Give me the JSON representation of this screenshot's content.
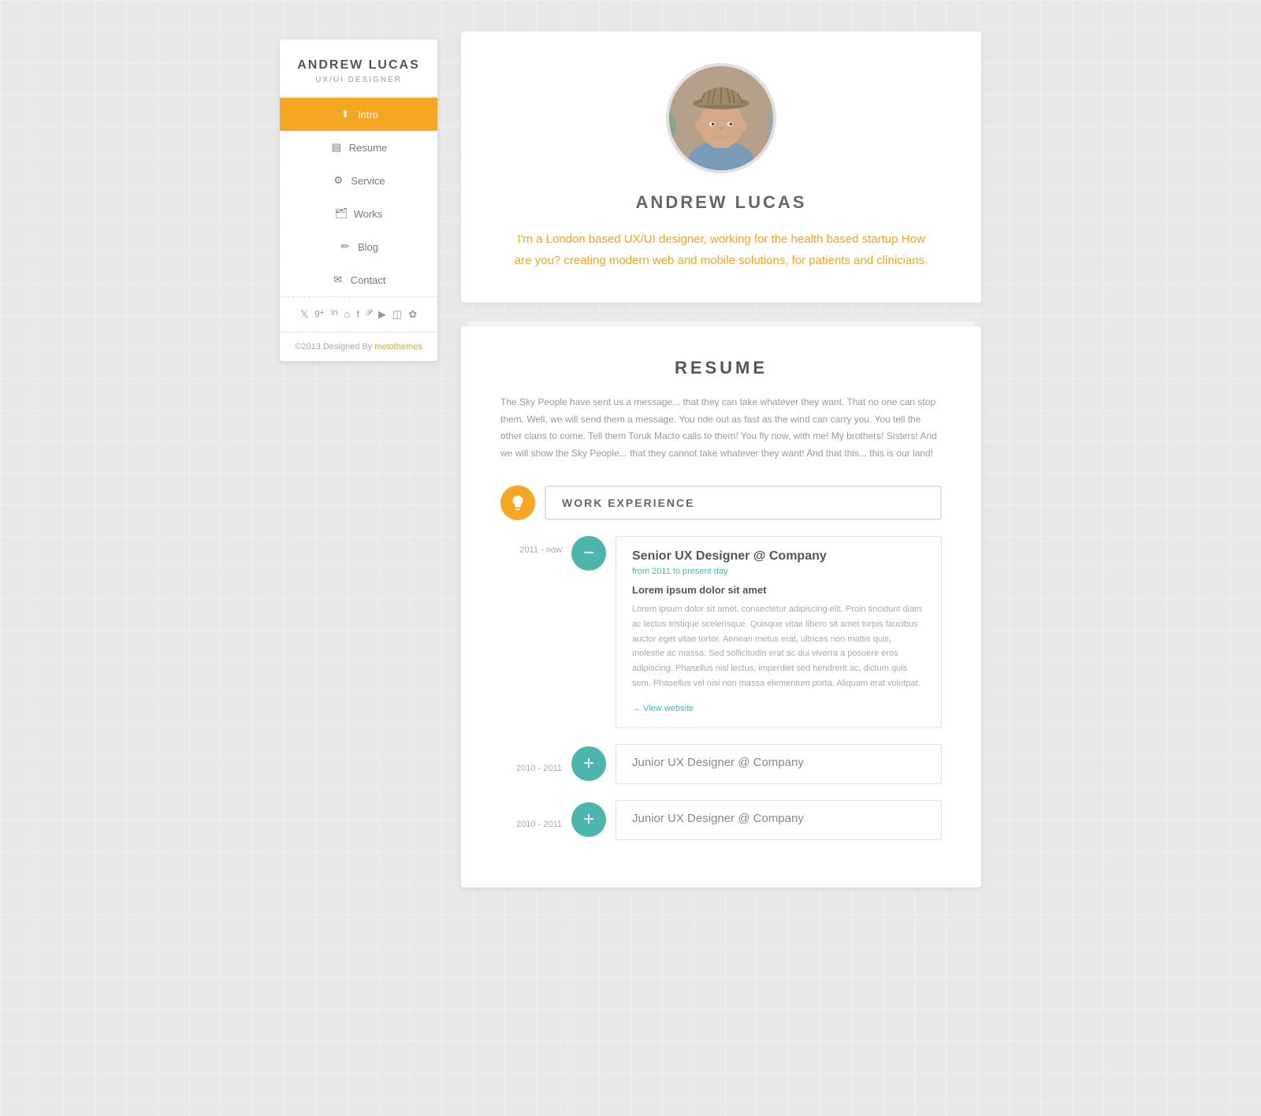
{
  "sidebar": {
    "name": "ANDREW LUCAS",
    "role": "UX/UI DESIGNER",
    "nav": [
      {
        "id": "intro",
        "label": "Intro",
        "icon": "⬆",
        "active": true
      },
      {
        "id": "resume",
        "label": "Resume",
        "icon": "📋",
        "active": false
      },
      {
        "id": "service",
        "label": "Service",
        "icon": "⚙",
        "active": false
      },
      {
        "id": "works",
        "label": "Works",
        "icon": "💼",
        "active": false
      },
      {
        "id": "blog",
        "label": "Blog",
        "icon": "✏",
        "active": false
      },
      {
        "id": "contact",
        "label": "Contact",
        "icon": "✉",
        "active": false
      }
    ],
    "social_icons": [
      "𝕏",
      "g⁺",
      "in",
      "⌂",
      "f",
      "𝓟",
      "▶",
      "📷",
      "✿"
    ],
    "footer_text": "©2013 Designed By ",
    "footer_link": "metothemes",
    "footer_link_url": "#"
  },
  "intro": {
    "name": "ANDREW LUCAS",
    "bio": "I'm a London based UX/UI designer, working for the health based startup How are you? creating modern web and mobile solutions, for patients and clinicians."
  },
  "resume": {
    "title": "RESUME",
    "intro_text": "The Sky People have sent us a message... that they can take whatever they want. That no one can stop them. Well, we will send them a message. You ride out as fast as the wind can carry you. You tell the other clans to come. Tell them Toruk Macto calls to them! You fly now, with me! My brothers! Sisters! And we will show the Sky People... that they cannot take whatever they want! And that this... this is our land!",
    "work_experience_label": "WORK EXPERIENCE",
    "items": [
      {
        "id": "job1",
        "years": "2011 - now",
        "title": "Senior UX Designer @ Company",
        "date_range": "from 2011 to present day",
        "content_title": "Lorem ipsum dolor sit amet",
        "content_body": "Lorem ipsum dolor sit amet, consectetur adipiscing elit. Proin tincidunt diam ac lectus tristique scelerisque. Quisque vitae libero sit amet turpis faucibus auctor eget vitae tortor. Aenean metus erat, ultrices non mattis quis, molestie ac massa. Sed sollicitudin erat ac dui viverra a posuere eros adipiscing. Phasellus nisl lectus, imperdiet sed hendrerit ac, dictum quis sem. Phasellus vel nisi non massa elementum porta. Aliquam erat volutpat.",
        "link_label": "→ View website",
        "expanded": true,
        "dot_type": "minus"
      },
      {
        "id": "job2",
        "years": "2010 - 2011",
        "title": "Junior UX Designer @ Company",
        "expanded": false,
        "dot_type": "plus"
      },
      {
        "id": "job3",
        "years": "2010 - 2011",
        "title": "Junior UX Designer @ Company",
        "expanded": false,
        "dot_type": "plus"
      }
    ]
  }
}
